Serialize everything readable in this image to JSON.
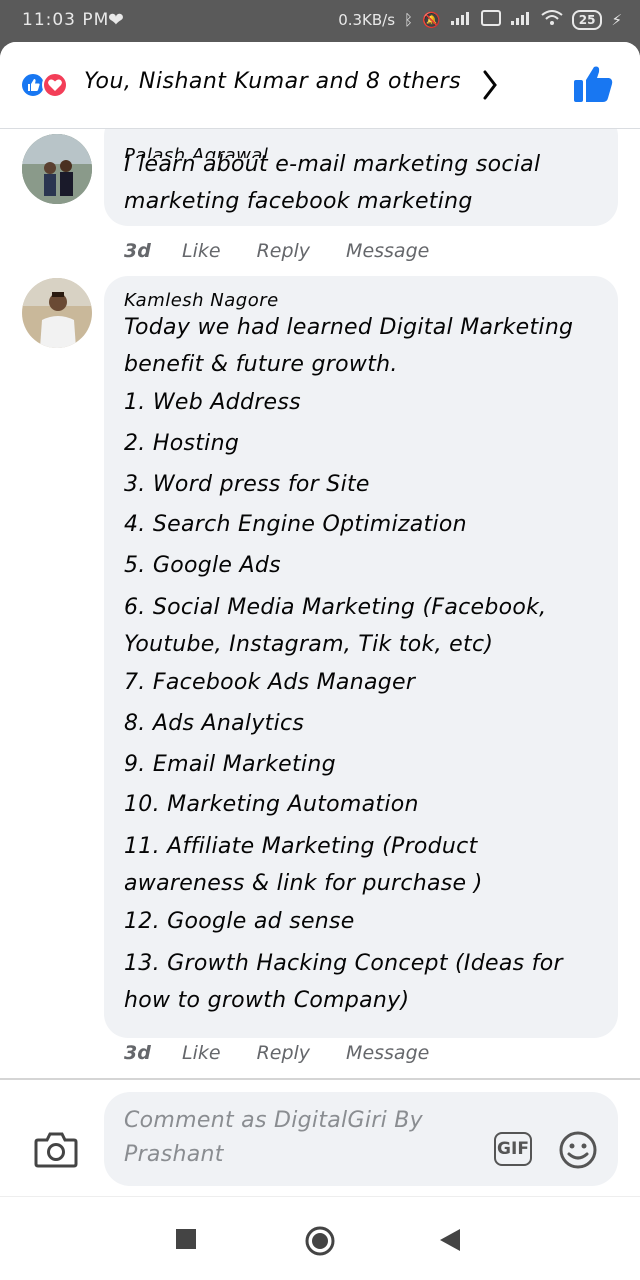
{
  "status_bar": {
    "time": "11:03 PM",
    "network_speed": "0.3KB/s",
    "battery": "25",
    "icons": [
      "heart-icon",
      "bluetooth-icon",
      "mute-icon",
      "signal-icon",
      "volte-icon",
      "wifi-icon",
      "battery-icon",
      "charging-icon"
    ]
  },
  "reactions": {
    "text": "You, Nishant Kumar and 8 others",
    "like_color": "#1877f2",
    "love_color": "#f33e58"
  },
  "comments": [
    {
      "author": "Palash Agrawal",
      "text": "I learn about e-mail marketing social marketing facebook marketing",
      "time": "3d",
      "actions": [
        "Like",
        "Reply",
        "Message"
      ]
    },
    {
      "author": "Kamlesh Nagore",
      "intro": "Today we had learned Digital Marketing benefit & future growth.",
      "items": [
        "1. Web Address",
        "2. Hosting",
        "3. Word press for Site",
        "4. Search Engine Optimization",
        "5. Google Ads",
        "6. Social Media Marketing (Facebook,",
        "Youtube, Instagram, Tik tok, etc)",
        "7. Facebook Ads Manager",
        "8. Ads Analytics",
        "9.  Email Marketing",
        "10.  Marketing Automation",
        "11. Affiliate Marketing (Product",
        "awareness & link for purchase )",
        "12. Google ad sense",
        "13. Growth Hacking  Concept (Ideas for",
        "how to growth Company)"
      ],
      "time": "3d",
      "actions": [
        "Like",
        "Reply",
        "Message"
      ]
    }
  ],
  "composer": {
    "placeholder": "Comment as DigitalGiri By Prashant",
    "gif_label": "GIF"
  }
}
